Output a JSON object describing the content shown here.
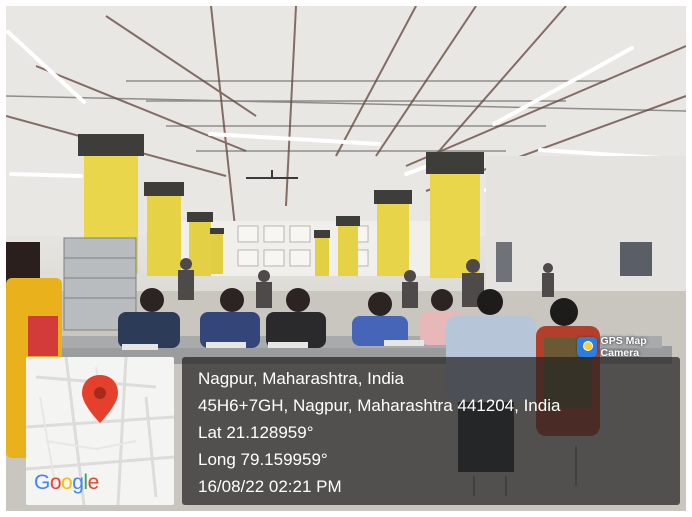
{
  "badge": {
    "label": "GPS Map Camera",
    "icon": "gps-map-camera-icon"
  },
  "map": {
    "pin_icon": "map-pin-icon",
    "logo_text": "Google"
  },
  "location": {
    "place": "Nagpur, Maharashtra, India",
    "address": "45H6+7GH, Nagpur, Maharashtra 441204, India",
    "lat": "Lat 21.128959°",
    "long": "Long 79.159959°",
    "datetime": "16/08/22 02:21 PM"
  },
  "colors": {
    "pillar_yellow": "#e9d64a",
    "pillar_cap": "#3d3d3a",
    "table_top": "#9a9c9e",
    "panel_bg": "#232323",
    "pin_red": "#e5402c"
  }
}
